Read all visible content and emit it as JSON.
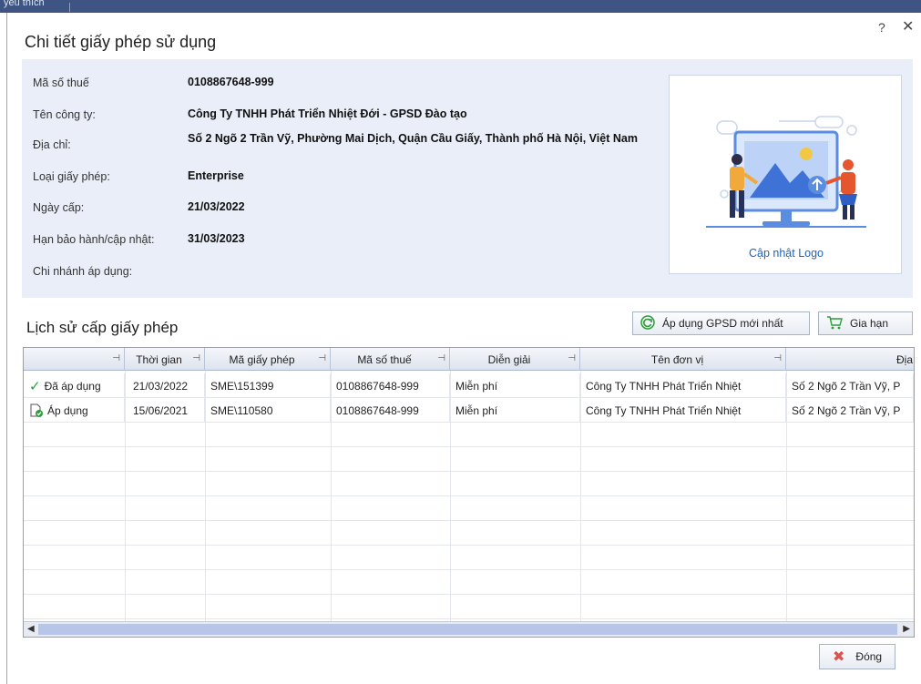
{
  "topbar": {
    "label": "yêu thích"
  },
  "dialog": {
    "title": "Chi tiết giấy phép sử dụng",
    "help": "?",
    "close": "✕"
  },
  "info": {
    "rows": [
      {
        "label": "Mã số thuế",
        "value": "0108867648-999"
      },
      {
        "label": "Tên công ty:",
        "value": "Công Ty TNHH Phát Triển Nhiệt Đới - GPSD Đào tạo"
      },
      {
        "label": "Địa chỉ:",
        "value": "Số 2 Ngõ 2 Trần Vỹ, Phường Mai Dịch, Quận Cầu Giấy, Thành phố Hà Nội, Việt Nam"
      },
      {
        "label": "Loại giấy phép:",
        "value": "Enterprise"
      },
      {
        "label": "Ngày cấp:",
        "value": "21/03/2022"
      },
      {
        "label": "Hạn bảo hành/cập nhật:",
        "value": "31/03/2023"
      },
      {
        "label": "Chi nhánh áp dụng:",
        "value": ""
      }
    ],
    "logo_link": "Cập nhật Logo"
  },
  "history": {
    "title": "Lịch sử cấp giấy phép",
    "apply_button": "Áp dụng GPSD mới nhất",
    "renew_button": "Gia hạn",
    "columns": [
      "",
      "Thời gian",
      "Mã giấy phép",
      "Mã số thuế",
      "Diễn giải",
      "Tên đơn vị",
      "Địa"
    ],
    "rows": [
      {
        "status": "Đã áp dụng",
        "icon": "check-icon",
        "date": "21/03/2022",
        "code": "SME\\151399",
        "tax": "0108867648-999",
        "desc": "Miễn phí",
        "unit": "Công Ty TNHH Phát Triển Nhiệt",
        "addr": "Số 2 Ngõ 2 Trần Vỹ, P"
      },
      {
        "status": "Áp dụng",
        "icon": "document-check-icon",
        "date": "15/06/2021",
        "code": "SME\\110580",
        "tax": "0108867648-999",
        "desc": "Miễn phí",
        "unit": "Công Ty TNHH Phát Triển Nhiệt",
        "addr": "Số 2 Ngõ 2 Trần Vỹ, P"
      }
    ]
  },
  "footer": {
    "close_button": "Đóng"
  },
  "colors": {
    "accent": "#1f63b8",
    "panel": "#e9eef8",
    "check": "#2e9d3a",
    "close_x": "#d9534f"
  }
}
